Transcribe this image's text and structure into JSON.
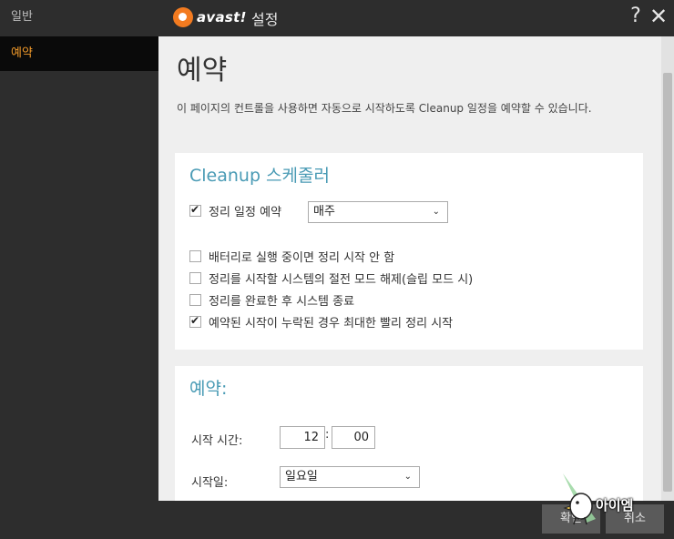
{
  "titlebar": {
    "brand": "avast!",
    "title": "설정",
    "help": "?",
    "close": "✕"
  },
  "sidebar": {
    "items": [
      {
        "label": "일반"
      },
      {
        "label": "예약"
      }
    ]
  },
  "page": {
    "title": "예약",
    "description": "이 페이지의 컨트롤을 사용하면 자동으로 시작하도록 Cleanup 일정을 예약할 수 있습니다."
  },
  "scheduler": {
    "title": "Cleanup 스케줄러",
    "schedule_label": "정리 일정 예약",
    "schedule_checked": true,
    "frequency": "매주",
    "options": [
      {
        "label": "배터리로 실행 중이면 정리 시작 안 함",
        "checked": false
      },
      {
        "label": "정리를 시작할 시스템의 절전 모드 해제(슬립 모드 시)",
        "checked": false
      },
      {
        "label": "정리를 완료한 후 시스템 종료",
        "checked": false
      },
      {
        "label": "예약된 시작이 누락된 경우 최대한 빨리 정리 시작",
        "checked": true
      }
    ]
  },
  "timing": {
    "title": "예약:",
    "start_time_label": "시작 시간:",
    "hour": "12",
    "separator": ":",
    "minute": "00",
    "start_day_label": "시작일:",
    "start_day": "일요일"
  },
  "footer": {
    "ok": "확인",
    "cancel": "취소"
  },
  "watermark": {
    "text": "아이엠"
  },
  "colors": {
    "accent_orange": "#f39b2a",
    "section_title": "#4a9bb5",
    "background_dark": "#2d2d2d"
  }
}
